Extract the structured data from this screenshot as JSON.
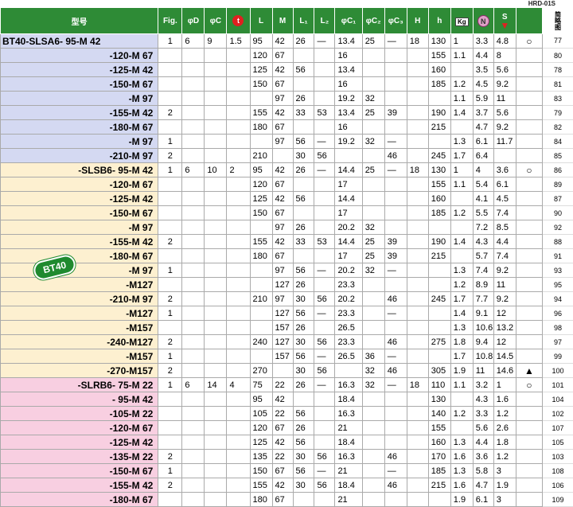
{
  "top_code": "HRD-01S",
  "header": {
    "model": "型号",
    "fig": "Fig.",
    "phiD": "φD",
    "phiC": "φC",
    "t": "t",
    "L": "L",
    "M": "M",
    "L1": "L₁",
    "L2": "L₂",
    "C1": "φC₁",
    "C2": "φC₂",
    "C3": "φC₃",
    "H": "H",
    "h": "h",
    "kg": "Kg",
    "n": "N",
    "s": "S",
    "last": "简略图"
  },
  "badge": "BT40",
  "rows": [
    {
      "model": "BT40-SLSA6- 95-M 42",
      "g": 1,
      "fig": "1",
      "d": "6",
      "c": "9",
      "t": "1.5",
      "L": "95",
      "M": "42",
      "L1": "26",
      "L2": "—",
      "C1": "13.4",
      "C2": "25",
      "C3": "—",
      "H": "18",
      "h": "130",
      "kg": "1",
      "n": "3.3",
      "s": "4.8",
      "mark": "○",
      "page": "77"
    },
    {
      "model": "-120-M 67",
      "g": 1,
      "fig": "",
      "d": "",
      "c": "",
      "t": "",
      "L": "120",
      "M": "67",
      "L1": "",
      "L2": "",
      "C1": "16",
      "C2": "",
      "C3": "",
      "H": "",
      "h": "155",
      "kg": "1.1",
      "n": "4.4",
      "s": "8",
      "mark": "",
      "page": "80"
    },
    {
      "model": "-125-M 42",
      "g": 1,
      "fig": "",
      "d": "",
      "c": "",
      "t": "",
      "L": "125",
      "M": "42",
      "L1": "56",
      "L2": "",
      "C1": "13.4",
      "C2": "",
      "C3": "",
      "H": "",
      "h": "160",
      "kg": "",
      "n": "3.5",
      "s": "5.6",
      "mark": "",
      "page": "78"
    },
    {
      "model": "-150-M 67",
      "g": 1,
      "fig": "",
      "d": "",
      "c": "",
      "t": "",
      "L": "150",
      "M": "67",
      "L1": "",
      "L2": "",
      "C1": "16",
      "C2": "",
      "C3": "",
      "H": "",
      "h": "185",
      "kg": "1.2",
      "n": "4.5",
      "s": "9.2",
      "mark": "",
      "page": "81"
    },
    {
      "model": "-M 97",
      "g": 1,
      "fig": "",
      "d": "",
      "c": "",
      "t": "",
      "L": "",
      "M": "97",
      "L1": "26",
      "L2": "",
      "C1": "19.2",
      "C2": "32",
      "C3": "",
      "H": "",
      "h": "",
      "kg": "1.1",
      "n": "5.9",
      "s": "11",
      "mark": "",
      "page": "83"
    },
    {
      "model": "-155-M 42",
      "g": 1,
      "fig": "2",
      "d": "",
      "c": "",
      "t": "",
      "L": "155",
      "M": "42",
      "L1": "33",
      "L2": "53",
      "C1": "13.4",
      "C2": "25",
      "C3": "39",
      "H": "",
      "h": "190",
      "kg": "1.4",
      "n": "3.7",
      "s": "5.6",
      "mark": "",
      "page": "79"
    },
    {
      "model": "-180-M 67",
      "g": 1,
      "fig": "",
      "d": "",
      "c": "",
      "t": "",
      "L": "180",
      "M": "67",
      "L1": "",
      "L2": "",
      "C1": "16",
      "C2": "",
      "C3": "",
      "H": "",
      "h": "215",
      "kg": "",
      "n": "4.7",
      "s": "9.2",
      "mark": "",
      "page": "82"
    },
    {
      "model": "-M 97",
      "g": 1,
      "fig": "1",
      "d": "",
      "c": "",
      "t": "",
      "L": "",
      "M": "97",
      "L1": "56",
      "L2": "—",
      "C1": "19.2",
      "C2": "32",
      "C3": "—",
      "H": "",
      "h": "",
      "kg": "1.3",
      "n": "6.1",
      "s": "11.7",
      "mark": "",
      "page": "84"
    },
    {
      "model": "-210-M 97",
      "g": 1,
      "fig": "2",
      "d": "",
      "c": "",
      "t": "",
      "L": "210",
      "M": "",
      "L1": "30",
      "L2": "56",
      "C1": "",
      "C2": "",
      "C3": "46",
      "H": "",
      "h": "245",
      "kg": "1.7",
      "n": "6.4",
      "s": "",
      "mark": "",
      "page": "85"
    },
    {
      "model": "-SLSB6- 95-M 42",
      "g": 2,
      "fig": "1",
      "d": "6",
      "c": "10",
      "t": "2",
      "L": "95",
      "M": "42",
      "L1": "26",
      "L2": "—",
      "C1": "14.4",
      "C2": "25",
      "C3": "—",
      "H": "18",
      "h": "130",
      "kg": "1",
      "n": "4",
      "s": "3.6",
      "mark": "○",
      "page": "86"
    },
    {
      "model": "-120-M 67",
      "g": 2,
      "fig": "",
      "d": "",
      "c": "",
      "t": "",
      "L": "120",
      "M": "67",
      "L1": "",
      "L2": "",
      "C1": "17",
      "C2": "",
      "C3": "",
      "H": "",
      "h": "155",
      "kg": "1.1",
      "n": "5.4",
      "s": "6.1",
      "mark": "",
      "page": "89"
    },
    {
      "model": "-125-M 42",
      "g": 2,
      "fig": "",
      "d": "",
      "c": "",
      "t": "",
      "L": "125",
      "M": "42",
      "L1": "56",
      "L2": "",
      "C1": "14.4",
      "C2": "",
      "C3": "",
      "H": "",
      "h": "160",
      "kg": "",
      "n": "4.1",
      "s": "4.5",
      "mark": "",
      "page": "87"
    },
    {
      "model": "-150-M 67",
      "g": 2,
      "fig": "",
      "d": "",
      "c": "",
      "t": "",
      "L": "150",
      "M": "67",
      "L1": "",
      "L2": "",
      "C1": "17",
      "C2": "",
      "C3": "",
      "H": "",
      "h": "185",
      "kg": "1.2",
      "n": "5.5",
      "s": "7.4",
      "mark": "",
      "page": "90"
    },
    {
      "model": "-M 97",
      "g": 2,
      "fig": "",
      "d": "",
      "c": "",
      "t": "",
      "L": "",
      "M": "97",
      "L1": "26",
      "L2": "",
      "C1": "20.2",
      "C2": "32",
      "C3": "",
      "H": "",
      "h": "",
      "kg": "",
      "n": "7.2",
      "s": "8.5",
      "mark": "",
      "page": "92"
    },
    {
      "model": "-155-M 42",
      "g": 2,
      "fig": "2",
      "d": "",
      "c": "",
      "t": "",
      "L": "155",
      "M": "42",
      "L1": "33",
      "L2": "53",
      "C1": "14.4",
      "C2": "25",
      "C3": "39",
      "H": "",
      "h": "190",
      "kg": "1.4",
      "n": "4.3",
      "s": "4.4",
      "mark": "",
      "page": "88"
    },
    {
      "model": "-180-M 67",
      "g": 2,
      "fig": "",
      "d": "",
      "c": "",
      "t": "",
      "L": "180",
      "M": "67",
      "L1": "",
      "L2": "",
      "C1": "17",
      "C2": "25",
      "C3": "39",
      "H": "",
      "h": "215",
      "kg": "",
      "n": "5.7",
      "s": "7.4",
      "mark": "",
      "page": "91"
    },
    {
      "model": "-M 97",
      "g": 2,
      "fig": "1",
      "d": "",
      "c": "",
      "t": "",
      "L": "",
      "M": "97",
      "L1": "56",
      "L2": "—",
      "C1": "20.2",
      "C2": "32",
      "C3": "—",
      "H": "",
      "h": "",
      "kg": "1.3",
      "n": "7.4",
      "s": "9.2",
      "mark": "",
      "page": "93"
    },
    {
      "model": "-M127",
      "g": 2,
      "fig": "",
      "d": "",
      "c": "",
      "t": "",
      "L": "",
      "M": "127",
      "L1": "26",
      "L2": "",
      "C1": "23.3",
      "C2": "",
      "C3": "",
      "H": "",
      "h": "",
      "kg": "1.2",
      "n": "8.9",
      "s": "11",
      "mark": "",
      "page": "95"
    },
    {
      "model": "-210-M 97",
      "g": 2,
      "fig": "2",
      "d": "",
      "c": "",
      "t": "",
      "L": "210",
      "M": "97",
      "L1": "30",
      "L2": "56",
      "C1": "20.2",
      "C2": "",
      "C3": "46",
      "H": "",
      "h": "245",
      "kg": "1.7",
      "n": "7.7",
      "s": "9.2",
      "mark": "",
      "page": "94"
    },
    {
      "model": "-M127",
      "g": 2,
      "fig": "1",
      "d": "",
      "c": "",
      "t": "",
      "L": "",
      "M": "127",
      "L1": "56",
      "L2": "—",
      "C1": "23.3",
      "C2": "",
      "C3": "—",
      "H": "",
      "h": "",
      "kg": "1.4",
      "n": "9.1",
      "s": "12",
      "mark": "",
      "page": "96"
    },
    {
      "model": "-M157",
      "g": 2,
      "fig": "",
      "d": "",
      "c": "",
      "t": "",
      "L": "",
      "M": "157",
      "L1": "26",
      "L2": "",
      "C1": "26.5",
      "C2": "",
      "C3": "",
      "H": "",
      "h": "",
      "kg": "1.3",
      "n": "10.6",
      "s": "13.2",
      "mark": "",
      "page": "98"
    },
    {
      "model": "-240-M127",
      "g": 2,
      "fig": "2",
      "d": "",
      "c": "",
      "t": "",
      "L": "240",
      "M": "127",
      "L1": "30",
      "L2": "56",
      "C1": "23.3",
      "C2": "",
      "C3": "46",
      "H": "",
      "h": "275",
      "kg": "1.8",
      "n": "9.4",
      "s": "12",
      "mark": "",
      "page": "97"
    },
    {
      "model": "-M157",
      "g": 2,
      "fig": "1",
      "d": "",
      "c": "",
      "t": "",
      "L": "",
      "M": "157",
      "L1": "56",
      "L2": "—",
      "C1": "26.5",
      "C2": "36",
      "C3": "—",
      "H": "",
      "h": "",
      "kg": "1.7",
      "n": "10.8",
      "s": "14.5",
      "mark": "",
      "page": "99"
    },
    {
      "model": "-270-M157",
      "g": 2,
      "fig": "2",
      "d": "",
      "c": "",
      "t": "",
      "L": "270",
      "M": "",
      "L1": "30",
      "L2": "56",
      "C1": "",
      "C2": "32",
      "C3": "46",
      "H": "",
      "h": "305",
      "kg": "1.9",
      "n": "11",
      "s": "14.6",
      "mark": "▲",
      "page": "100"
    },
    {
      "model": "-SLRB6- 75-M 22",
      "g": 3,
      "fig": "1",
      "d": "6",
      "c": "14",
      "t": "4",
      "L": "75",
      "M": "22",
      "L1": "26",
      "L2": "—",
      "C1": "16.3",
      "C2": "32",
      "C3": "—",
      "H": "18",
      "h": "110",
      "kg": "1.1",
      "n": "3.2",
      "s": "1",
      "mark": "○",
      "page": "101"
    },
    {
      "model": "- 95-M 42",
      "g": 3,
      "fig": "",
      "d": "",
      "c": "",
      "t": "",
      "L": "95",
      "M": "42",
      "L1": "",
      "L2": "",
      "C1": "18.4",
      "C2": "",
      "C3": "",
      "H": "",
      "h": "130",
      "kg": "",
      "n": "4.3",
      "s": "1.6",
      "mark": "",
      "page": "104"
    },
    {
      "model": "-105-M 22",
      "g": 3,
      "fig": "",
      "d": "",
      "c": "",
      "t": "",
      "L": "105",
      "M": "22",
      "L1": "56",
      "L2": "",
      "C1": "16.3",
      "C2": "",
      "C3": "",
      "H": "",
      "h": "140",
      "kg": "1.2",
      "n": "3.3",
      "s": "1.2",
      "mark": "",
      "page": "102"
    },
    {
      "model": "-120-M 67",
      "g": 3,
      "fig": "",
      "d": "",
      "c": "",
      "t": "",
      "L": "120",
      "M": "67",
      "L1": "26",
      "L2": "",
      "C1": "21",
      "C2": "",
      "C3": "",
      "H": "",
      "h": "155",
      "kg": "",
      "n": "5.6",
      "s": "2.6",
      "mark": "",
      "page": "107"
    },
    {
      "model": "-125-M 42",
      "g": 3,
      "fig": "",
      "d": "",
      "c": "",
      "t": "",
      "L": "125",
      "M": "42",
      "L1": "56",
      "L2": "",
      "C1": "18.4",
      "C2": "",
      "C3": "",
      "H": "",
      "h": "160",
      "kg": "1.3",
      "n": "4.4",
      "s": "1.8",
      "mark": "",
      "page": "105"
    },
    {
      "model": "-135-M 22",
      "g": 3,
      "fig": "2",
      "d": "",
      "c": "",
      "t": "",
      "L": "135",
      "M": "22",
      "L1": "30",
      "L2": "56",
      "C1": "16.3",
      "C2": "",
      "C3": "46",
      "H": "",
      "h": "170",
      "kg": "1.6",
      "n": "3.6",
      "s": "1.2",
      "mark": "",
      "page": "103"
    },
    {
      "model": "-150-M 67",
      "g": 3,
      "fig": "1",
      "d": "",
      "c": "",
      "t": "",
      "L": "150",
      "M": "67",
      "L1": "56",
      "L2": "—",
      "C1": "21",
      "C2": "",
      "C3": "—",
      "H": "",
      "h": "185",
      "kg": "1.3",
      "n": "5.8",
      "s": "3",
      "mark": "",
      "page": "108"
    },
    {
      "model": "-155-M 42",
      "g": 3,
      "fig": "2",
      "d": "",
      "c": "",
      "t": "",
      "L": "155",
      "M": "42",
      "L1": "30",
      "L2": "56",
      "C1": "18.4",
      "C2": "",
      "C3": "46",
      "H": "",
      "h": "215",
      "kg": "1.6",
      "n": "4.7",
      "s": "1.9",
      "mark": "",
      "page": "106"
    },
    {
      "model": "-180-M 67",
      "g": 3,
      "fig": "",
      "d": "",
      "c": "",
      "t": "",
      "L": "180",
      "M": "67",
      "L1": "",
      "L2": "",
      "C1": "21",
      "C2": "",
      "C3": "",
      "H": "",
      "h": "",
      "kg": "1.9",
      "n": "6.1",
      "s": "3",
      "mark": "",
      "page": "109"
    }
  ]
}
